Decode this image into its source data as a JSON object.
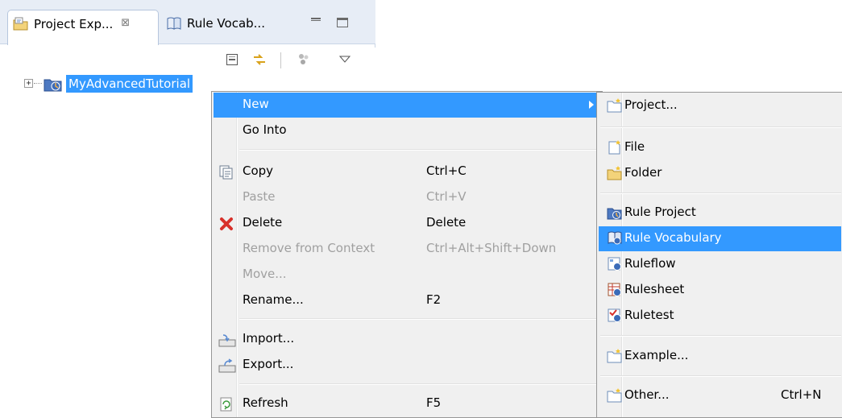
{
  "tabs": [
    {
      "label": "Project Exp...",
      "close": "⊠",
      "icon": "project-explorer-icon"
    },
    {
      "label": "Rule Vocab...",
      "icon": "rule-vocabulary-book-icon"
    }
  ],
  "tree": {
    "expander": "+",
    "project_name": "MyAdvancedTutorial"
  },
  "context_menu": {
    "items": [
      {
        "label": "New",
        "accel": ""
      },
      {
        "label": "Go Into",
        "accel": ""
      },
      {
        "label": "Copy",
        "accel": "Ctrl+C"
      },
      {
        "label": "Paste",
        "accel": "Ctrl+V"
      },
      {
        "label": "Delete",
        "accel": "Delete"
      },
      {
        "label": "Remove from Context",
        "accel": "Ctrl+Alt+Shift+Down"
      },
      {
        "label": "Move...",
        "accel": ""
      },
      {
        "label": "Rename...",
        "accel": "F2"
      },
      {
        "label": "Import...",
        "accel": ""
      },
      {
        "label": "Export...",
        "accel": ""
      },
      {
        "label": "Refresh",
        "accel": "F5"
      }
    ]
  },
  "submenu": {
    "items": [
      {
        "label": "Project...",
        "accel": ""
      },
      {
        "label": "File",
        "accel": ""
      },
      {
        "label": "Folder",
        "accel": ""
      },
      {
        "label": "Rule Project",
        "accel": ""
      },
      {
        "label": "Rule Vocabulary",
        "accel": ""
      },
      {
        "label": "Ruleflow",
        "accel": ""
      },
      {
        "label": "Rulesheet",
        "accel": ""
      },
      {
        "label": "Ruletest",
        "accel": ""
      },
      {
        "label": "Example...",
        "accel": ""
      },
      {
        "label": "Other...",
        "accel": "Ctrl+N"
      }
    ]
  },
  "colors": {
    "selection": "#3399ff",
    "menu_bg": "#f0f0f0",
    "tabbar_bg": "#e7edf6"
  }
}
